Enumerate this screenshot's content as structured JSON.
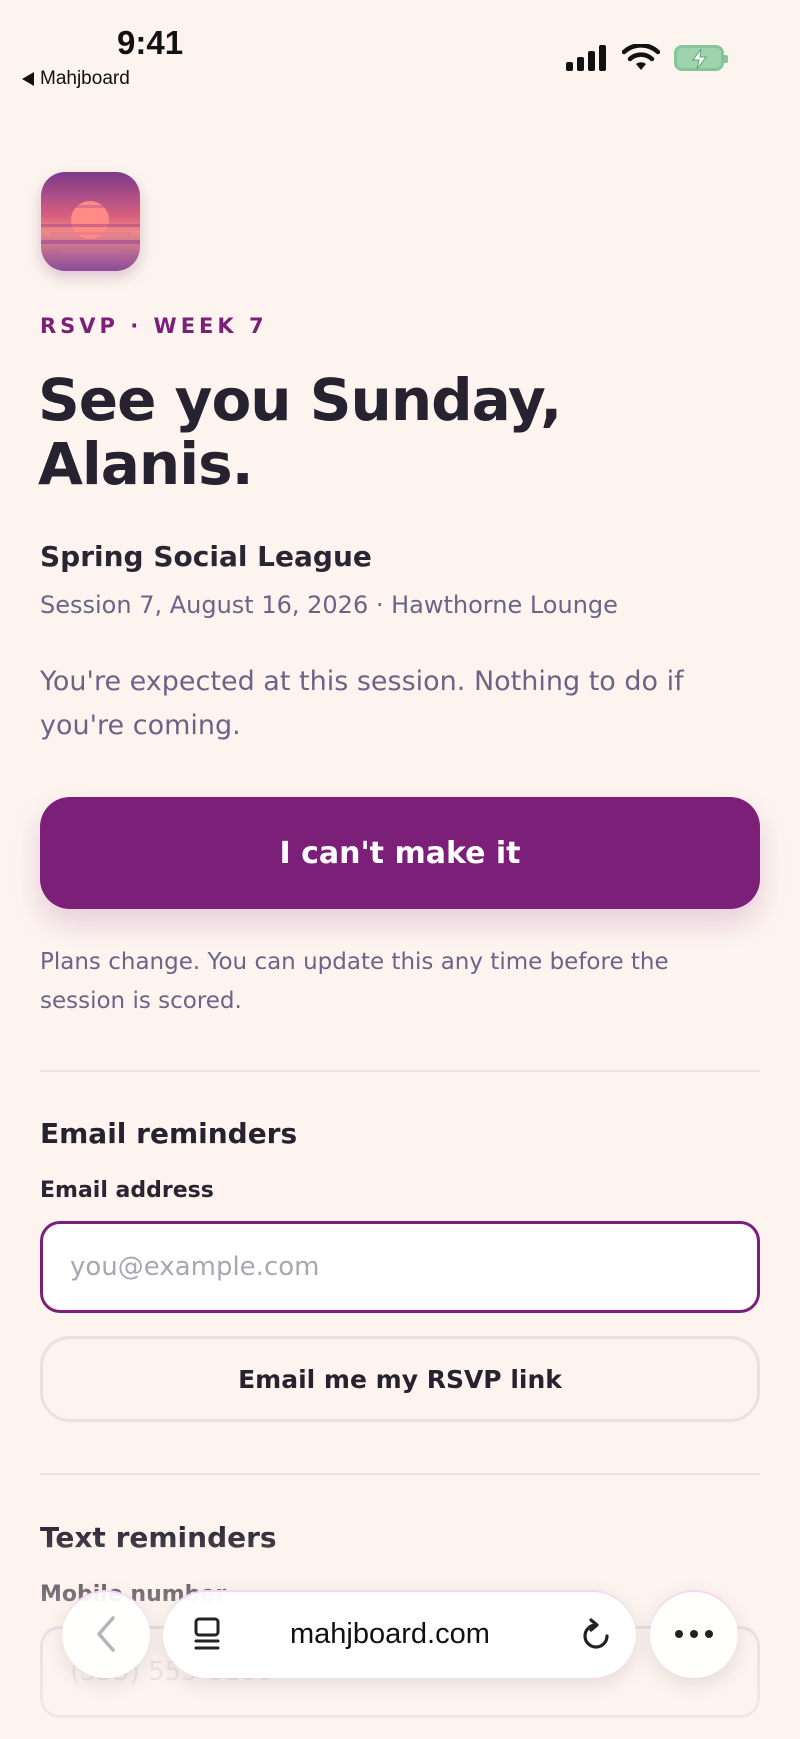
{
  "status_bar": {
    "time": "9:41",
    "back_app": "Mahjboard"
  },
  "rsvp": {
    "kicker": "RSVP · WEEK 7",
    "headline_line1": "See you Sunday,",
    "headline_line2": "Alanis.",
    "league": "Spring Social League",
    "session": "Session 7, August 16, 2026 · Hawthorne Lounge",
    "expected_text": "You're expected at this session. Nothing to do if you're coming.",
    "cant_make_it_label": "I can't make it",
    "plans_text": "Plans change. You can update this any time before the session is scored."
  },
  "email_reminders": {
    "title": "Email reminders",
    "field_label": "Email address",
    "placeholder": "you@example.com",
    "button_label": "Email me my RSVP link"
  },
  "text_reminders": {
    "title": "Text reminders",
    "field_label": "Mobile number",
    "placeholder": "(555) 555-0100"
  },
  "browser": {
    "url": "mahjboard.com"
  },
  "icons": {
    "back": "chevron-left-icon",
    "tabs": "tabs-icon",
    "reload": "reload-icon",
    "more": "more-icon"
  },
  "colors": {
    "accent": "#7b1f78",
    "background": "#fdf4ef",
    "muted_text": "#6a6487"
  }
}
